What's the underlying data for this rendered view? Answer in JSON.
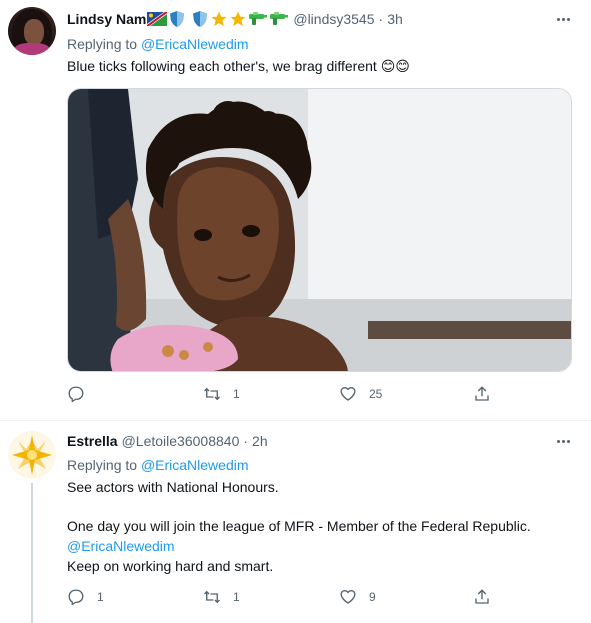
{
  "tweets": [
    {
      "name": "Lindsy Nam",
      "handle": "@lindsy3545",
      "time": "3h",
      "replying_prefix": "Replying to",
      "replying_to": "@EricaNlewedim",
      "body": "Blue ticks following each other's,  we brag different 😊😊",
      "icons": [
        "namibia-flag-icon",
        "shield-icon",
        "shield-icon",
        "star-icon",
        "star-icon",
        "water-gun-icon",
        "water-gun-icon"
      ],
      "media": "photo of a smiling toddler with curly hair holding a pink plate",
      "stats": {
        "reply": "",
        "retweet": "1",
        "like": "25"
      }
    },
    {
      "name": "Estrella",
      "handle": "@Letoile36008840",
      "time": "2h",
      "replying_prefix": "Replying to",
      "replying_to": "@EricaNlewedim",
      "body_lines": [
        "See actors with National Honours.",
        "One day you will join the league of MFR - Member of the Federal Republic.",
        "@EricaNlewedim",
        "Keep on working hard and smart."
      ],
      "stats": {
        "reply": "1",
        "retweet": "1",
        "like": "9"
      }
    }
  ],
  "colors": {
    "accent": "#1d9bf0",
    "secondary_text": "#536471",
    "primary_text": "#0f1419"
  }
}
